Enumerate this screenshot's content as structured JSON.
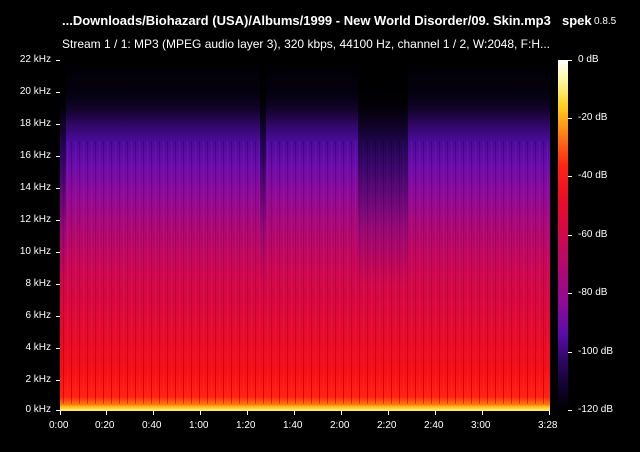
{
  "header": {
    "file_title": "...Downloads/Biohazard (USA)/Albums/1999 - New World Disorder/09. Skin.mp3",
    "app_name": "spek",
    "app_version": "0.8.5",
    "stream_info": "Stream 1 / 1: MP3 (MPEG audio layer 3), 320 kbps, 44100 Hz, channel 1 / 2, W:2048, F:H..."
  },
  "frequency_axis": {
    "labels": [
      "22 kHz",
      "20 kHz",
      "18 kHz",
      "16 kHz",
      "14 kHz",
      "12 kHz",
      "10 kHz",
      "8 kHz",
      "6 kHz",
      "4 kHz",
      "2 kHz",
      "0 kHz"
    ]
  },
  "time_axis": {
    "labels": [
      "0:00",
      "0:20",
      "0:40",
      "1:00",
      "1:20",
      "1:40",
      "2:00",
      "2:20",
      "2:40",
      "3:00",
      "3:28"
    ]
  },
  "db_scale": {
    "labels": [
      "0 dB",
      "-20 dB",
      "-40 dB",
      "-60 dB",
      "-80 dB",
      "-100 dB",
      "-120 dB"
    ]
  },
  "colors": {
    "background": "#000000",
    "hot": "#ffd21e",
    "mid": "#e00a34",
    "cool": "#6a0ca8"
  }
}
